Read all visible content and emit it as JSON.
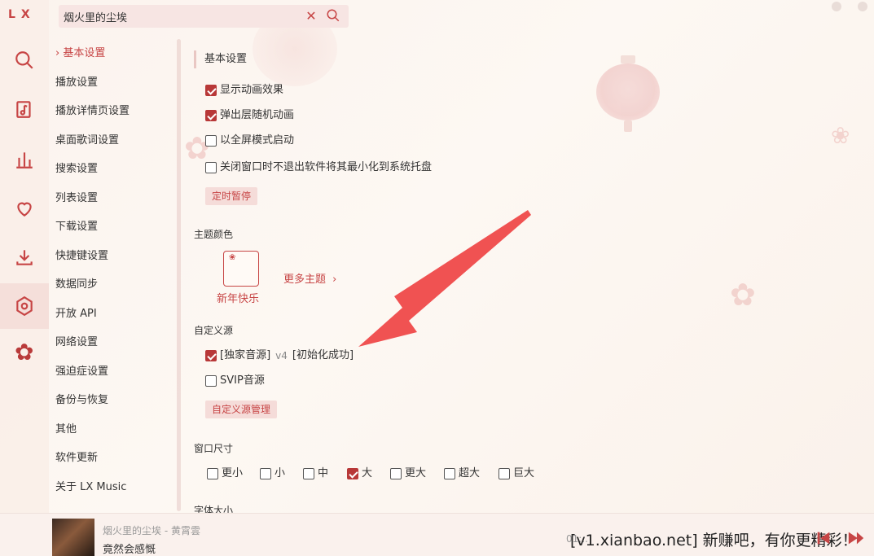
{
  "app": {
    "logo": "LX"
  },
  "search": {
    "value": "烟火里的尘埃"
  },
  "nav": {
    "items": [
      {
        "label": "基本设置",
        "active": true
      },
      {
        "label": "播放设置"
      },
      {
        "label": "播放详情页设置"
      },
      {
        "label": "桌面歌词设置"
      },
      {
        "label": "搜索设置"
      },
      {
        "label": "列表设置"
      },
      {
        "label": "下载设置"
      },
      {
        "label": "快捷键设置"
      },
      {
        "label": "数据同步"
      },
      {
        "label": "开放 API"
      },
      {
        "label": "网络设置"
      },
      {
        "label": "强迫症设置"
      },
      {
        "label": "备份与恢复"
      },
      {
        "label": "其他"
      },
      {
        "label": "软件更新"
      },
      {
        "label": "关于 LX Music"
      }
    ],
    "active_marker": "›"
  },
  "basic": {
    "title": "基本设置",
    "options": [
      {
        "label": "显示动画效果",
        "checked": true
      },
      {
        "label": "弹出层随机动画",
        "checked": true
      },
      {
        "label": "以全屏模式启动",
        "checked": false
      },
      {
        "label": "关闭窗口时不退出软件将其最小化到系统托盘",
        "checked": false
      }
    ],
    "timer_button": "定时暂停"
  },
  "theme": {
    "title": "主题颜色",
    "current": "新年快乐",
    "more": "更多主题"
  },
  "source": {
    "title": "自定义源",
    "items": [
      {
        "name": "[独家音源]",
        "version": "v4",
        "status": "[初始化成功]",
        "checked": true
      },
      {
        "name": "SVIP音源",
        "checked": false
      }
    ],
    "manage_button": "自定义源管理"
  },
  "window_size": {
    "title": "窗口尺寸",
    "options": [
      {
        "label": "更小",
        "checked": false
      },
      {
        "label": "小",
        "checked": false
      },
      {
        "label": "中",
        "checked": false
      },
      {
        "label": "大",
        "checked": true
      },
      {
        "label": "更大",
        "checked": false
      },
      {
        "label": "超大",
        "checked": false
      },
      {
        "label": "巨大",
        "checked": false
      }
    ]
  },
  "font_size": {
    "title": "字体大小"
  },
  "player": {
    "title": "烟火里的尘埃 - 黄霄雲",
    "lyric": "竟然会感慨",
    "time": "01:..",
    "watermark": "[v1.xianbao.net] 新赚吧，有你更精彩！"
  },
  "colors": {
    "accent": "#c74545",
    "checked": "#b83838",
    "arrow": "#f05252"
  }
}
